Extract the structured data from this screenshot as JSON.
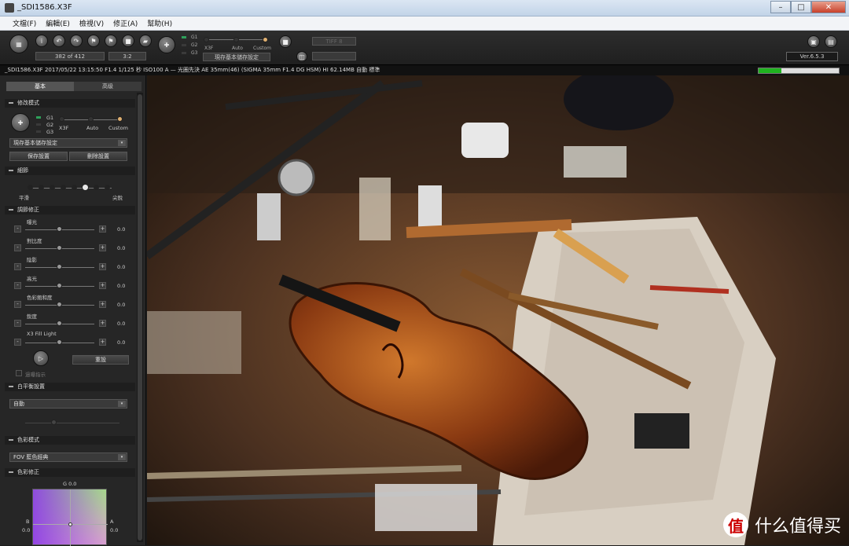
{
  "window": {
    "title": "_SDI1586.X3F"
  },
  "menu": [
    "文檔(F)",
    "編輯(E)",
    "檢視(V)",
    "修正(A)",
    "幫助(H)"
  ],
  "toolbar": {
    "counter": "382 of 412",
    "ratio": "3:2",
    "mode_labels": {
      "g1": "G1",
      "g2": "G2",
      "g3": "G3",
      "x3f": "X3F",
      "auto": "Auto",
      "custom": "Custom"
    },
    "preset": "現存基本儲存設定",
    "tif_field": "TIFF 8",
    "version": "Ver.6.5.3"
  },
  "info": {
    "text": "_SDI1586.X3F 2017/05/22 13:15:50 F1.4 1/125 秒 ISO100 A — 光圈先決 AE 35mm(46) (SIGMA 35mm F1.4 DG HSM) HI 62.14MB 自動 標準",
    "progress": 0.28
  },
  "panel": {
    "tabs": [
      "基本",
      "高级"
    ],
    "sec_mode": {
      "title": "修改模式",
      "g1": "G1",
      "g2": "G2",
      "g3": "G3",
      "x3f": "X3F",
      "auto": "Auto",
      "custom": "Custom",
      "preset": "現存基本儲存設定",
      "save": "保存設置",
      "delete": "刪除設置"
    },
    "sec_detail": {
      "title": "細節",
      "left": "平滑",
      "right": "尖銳"
    },
    "sec_tone": {
      "title": "調節修正",
      "sliders": [
        {
          "label": "曝光",
          "value": "0.0"
        },
        {
          "label": "對比度",
          "value": "0.0"
        },
        {
          "label": "陰影",
          "value": "0.0"
        },
        {
          "label": "高光",
          "value": "0.0"
        },
        {
          "label": "色彩飽和度",
          "value": "0.0"
        },
        {
          "label": "銳度",
          "value": "0.0"
        },
        {
          "label": "X3 Fill Light",
          "value": "0.0"
        }
      ],
      "reset": "重設",
      "checkbox": "過曝指示"
    },
    "sec_wb": {
      "title": "白平衡設置",
      "value": "自動"
    },
    "sec_color_mode": {
      "title": "色彩模式",
      "value": "FOV 藍色經典"
    },
    "sec_color_fix": {
      "title": "色彩修正",
      "g": "G 0.0",
      "b": "B",
      "b_val": "0.0",
      "a": "A",
      "a_val": "0.0"
    }
  },
  "watermark": {
    "logo": "值",
    "text": "什么值得买"
  },
  "colors": {
    "accent_green": "#2ea05a",
    "progress_green": "#1fb31f",
    "panel_bg": "#262626"
  }
}
